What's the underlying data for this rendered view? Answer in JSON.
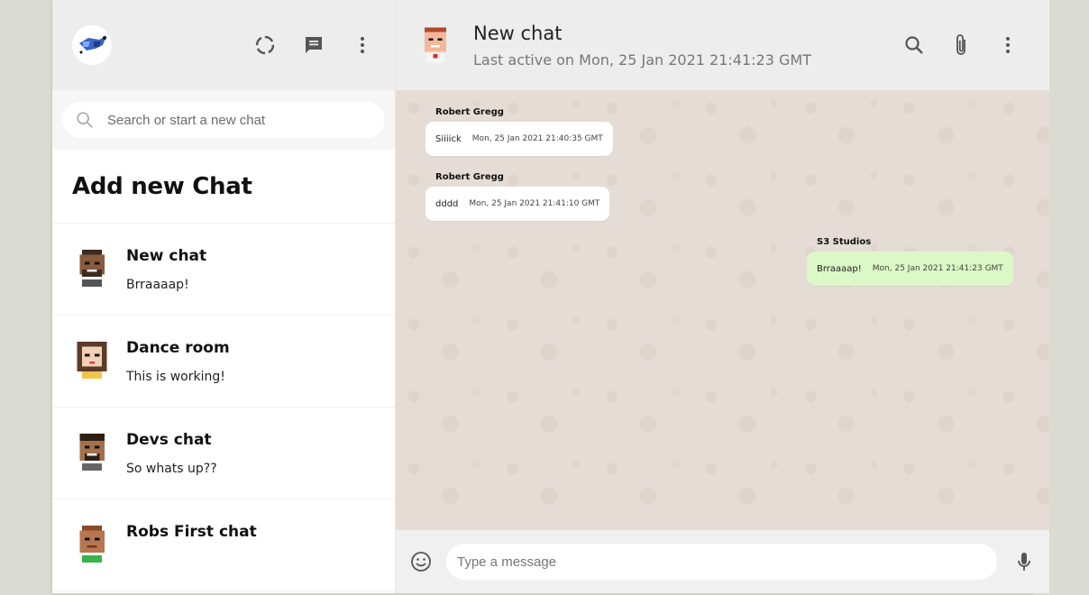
{
  "sidebar": {
    "icons": {
      "status": "status-ring-icon",
      "chat": "chat-icon",
      "menu": "vertical-dots-menu-icon"
    },
    "search": {
      "placeholder": "Search or start a new chat"
    },
    "add_chat_label": "Add new Chat",
    "chats": [
      {
        "name": "New chat",
        "last": "Brraaaap!",
        "avatar_skin": "#8a5a3c",
        "avatar_hair": "#3b2a20"
      },
      {
        "name": "Dance room",
        "last": "This is working!",
        "avatar_skin": "#f3d1b5",
        "avatar_hair": "#5a3a28"
      },
      {
        "name": "Devs chat",
        "last": "So whats up??",
        "avatar_skin": "#a4714a",
        "avatar_hair": "#2e1f15"
      },
      {
        "name": "Robs First chat",
        "last": "",
        "avatar_skin": "#b87650",
        "avatar_hair": "#8a4a2a"
      }
    ]
  },
  "header": {
    "title": "New chat",
    "subtitle": "Last active on Mon, 25 Jan 2021 21:41:23 GMT",
    "icons": {
      "search": "search-icon",
      "attach": "paperclip-icon",
      "menu": "vertical-dots-menu-icon"
    }
  },
  "messages": [
    {
      "sender": "Robert Gregg",
      "text": "Siiiick",
      "time": "Mon, 25 Jan 2021 21:40:35 GMT",
      "mine": false
    },
    {
      "sender": "Robert Gregg",
      "text": "dddd",
      "time": "Mon, 25 Jan 2021 21:41:10 GMT",
      "mine": false
    },
    {
      "sender": "S3 Studios",
      "text": "Brraaaap!",
      "time": "Mon, 25 Jan 2021 21:41:23 GMT",
      "mine": true
    }
  ],
  "footer": {
    "placeholder": "Type a message",
    "icons": {
      "emoji": "emoji-icon",
      "mic": "microphone-icon"
    }
  },
  "colors": {
    "header_bg": "#ededed",
    "chat_bg": "#e5ddd5",
    "outgoing_bubble": "#dcf8c6",
    "incoming_bubble": "#ffffff"
  }
}
